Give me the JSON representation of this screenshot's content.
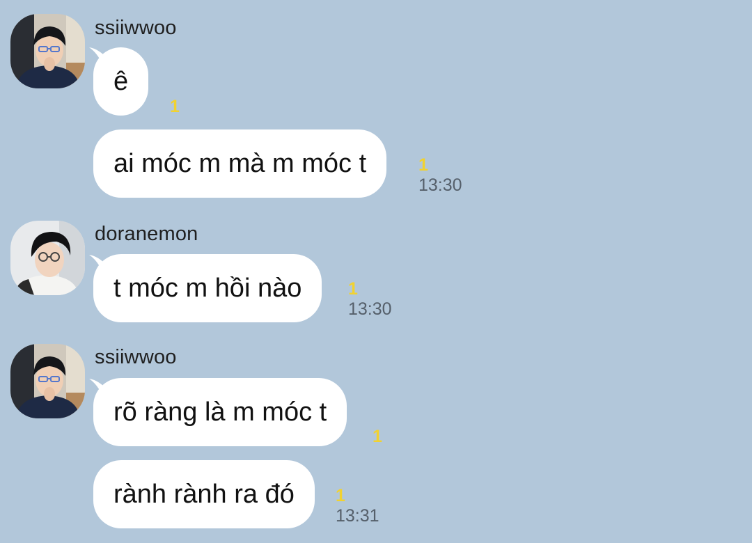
{
  "chat": {
    "messages": [
      {
        "sender": "ssiiwwoo",
        "bubbles": [
          {
            "text": "ê",
            "unread": "1",
            "time": ""
          },
          {
            "text": "ai móc m mà m móc t",
            "unread": "1",
            "time": "13:30"
          }
        ]
      },
      {
        "sender": "doranemon",
        "bubbles": [
          {
            "text": "t móc m hồi nào",
            "unread": "1",
            "time": "13:30"
          }
        ]
      },
      {
        "sender": "ssiiwwoo",
        "bubbles": [
          {
            "text": "rõ ràng là m móc t",
            "unread": "1",
            "time": ""
          },
          {
            "text": "rành rành ra đó",
            "unread": "1",
            "time": "13:31"
          }
        ]
      }
    ]
  },
  "colors": {
    "background": "#b2c7da",
    "bubble": "#ffffff",
    "unread": "#f1d230",
    "time": "#555f6a"
  }
}
